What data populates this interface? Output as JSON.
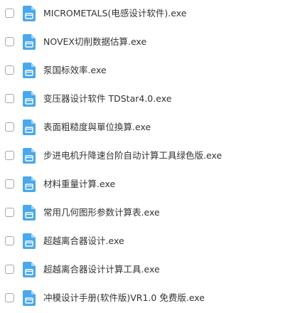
{
  "colors": {
    "icon_blue": "#4aa8ec",
    "icon_fold": "#a9d5f7",
    "text": "#333333",
    "checkbox_border": "#a9a9a9"
  },
  "file_icon": "exe-file-icon",
  "files": [
    {
      "name": "MICROMETALS(电感设计软件).exe"
    },
    {
      "name": "NOVEX切削数据估算.exe"
    },
    {
      "name": "泵国标效率.exe"
    },
    {
      "name": "变压器设计软件 TDStar4.0.exe"
    },
    {
      "name": "表面粗糙度與單位換算.exe"
    },
    {
      "name": "步进电机升降速台阶自动计算工具绿色版.exe"
    },
    {
      "name": "材料重量计算.exe"
    },
    {
      "name": "常用几何图形参数计算表.exe"
    },
    {
      "name": "超越离合器设计.exe"
    },
    {
      "name": "超越离合器设计计算工具.exe"
    },
    {
      "name": "冲模设计手册(软件版)VR1.0 免费版.exe"
    }
  ]
}
